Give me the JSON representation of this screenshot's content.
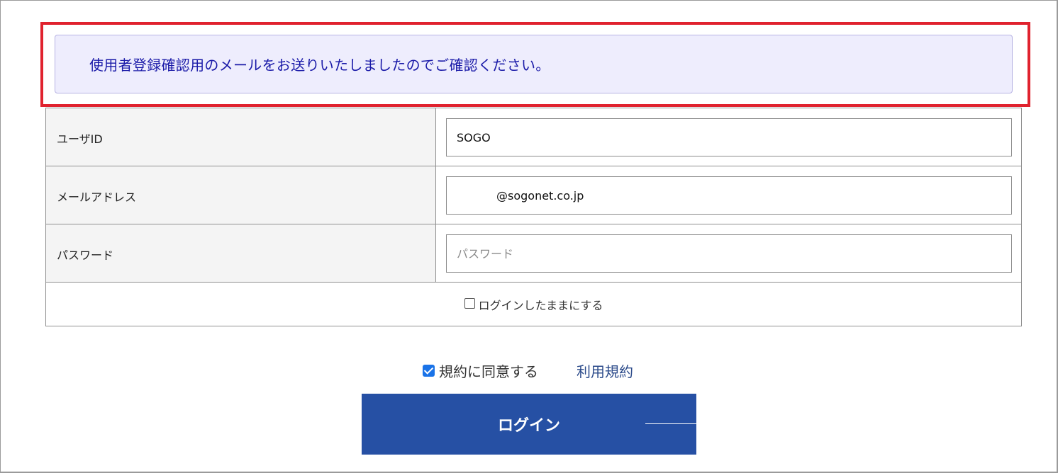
{
  "notice": {
    "message": "使用者登録確認用のメールをお送りいたしましたのでご確認ください。"
  },
  "form": {
    "user_id": {
      "label": "ユーザID",
      "value": "SOGO"
    },
    "email": {
      "label": "メールアドレス",
      "value": "@sogonet.co.jp"
    },
    "password": {
      "label": "パスワード",
      "placeholder": "パスワード",
      "value": ""
    },
    "remember": {
      "label": "ログインしたままにする",
      "checked": false
    }
  },
  "agreement": {
    "label": "規約に同意する",
    "checked": true,
    "terms_link": "利用規約"
  },
  "login_button": {
    "label": "ログイン"
  },
  "colors": {
    "highlight": "#e0222e",
    "notice_bg": "#eeedfd",
    "notice_text": "#1a1aa8",
    "button_bg": "#2650a4",
    "link": "#2b4a8a",
    "checkbox": "#1a73e8"
  }
}
